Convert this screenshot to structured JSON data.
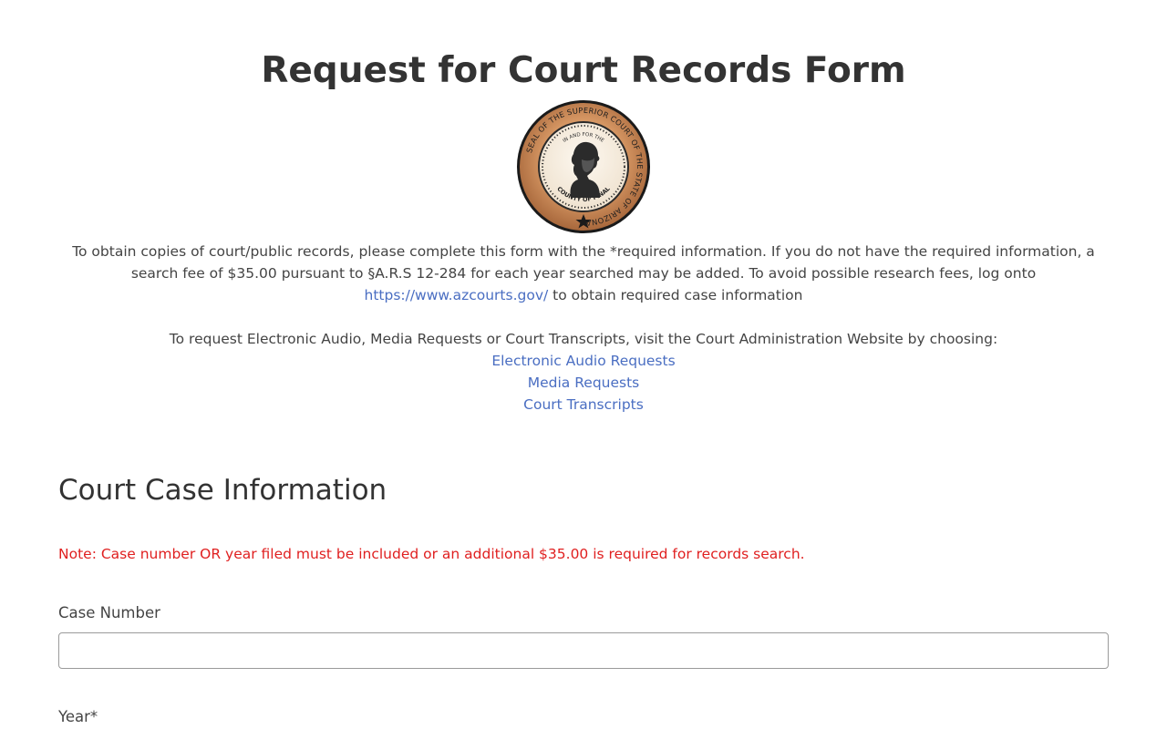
{
  "header": {
    "title": "Request for Court Records Form"
  },
  "seal": {
    "icon": "court-seal-icon",
    "ring_text": "SEAL OF THE SUPERIOR COURT OF THE STATE OF ARIZONA",
    "inner_top_text": "IN AND FOR THE",
    "inner_bottom_text": "COUNTY OF PINAL"
  },
  "intro": {
    "text_part1": "To obtain copies of court/public records, please complete this form with the *required information. If you do not have the required information, a search fee of $35.00 pursuant to §A.R.S 12-284 for each year searched may be added. To avoid possible research fees, log onto ",
    "link_text": "https://www.azcourts.gov/",
    "text_part2": " to obtain required case information"
  },
  "admin_links": {
    "text": "To request Electronic Audio, Media Requests or Court Transcripts, visit the Court Administration Website by choosing:",
    "items": [
      {
        "label": "Electronic Audio Requests"
      },
      {
        "label": "Media Requests"
      },
      {
        "label": "Court Transcripts"
      }
    ]
  },
  "form": {
    "section_title": "Court Case Information",
    "note": "Note: Case number OR year filed must be included or an additional $35.00 is required for records search.",
    "case_number_label": "Case Number",
    "case_number_value": "",
    "year_label": "Year*"
  },
  "colors": {
    "link": "#4a6ec2",
    "note": "#e02020",
    "seal_bronze": "#c98a5a"
  }
}
